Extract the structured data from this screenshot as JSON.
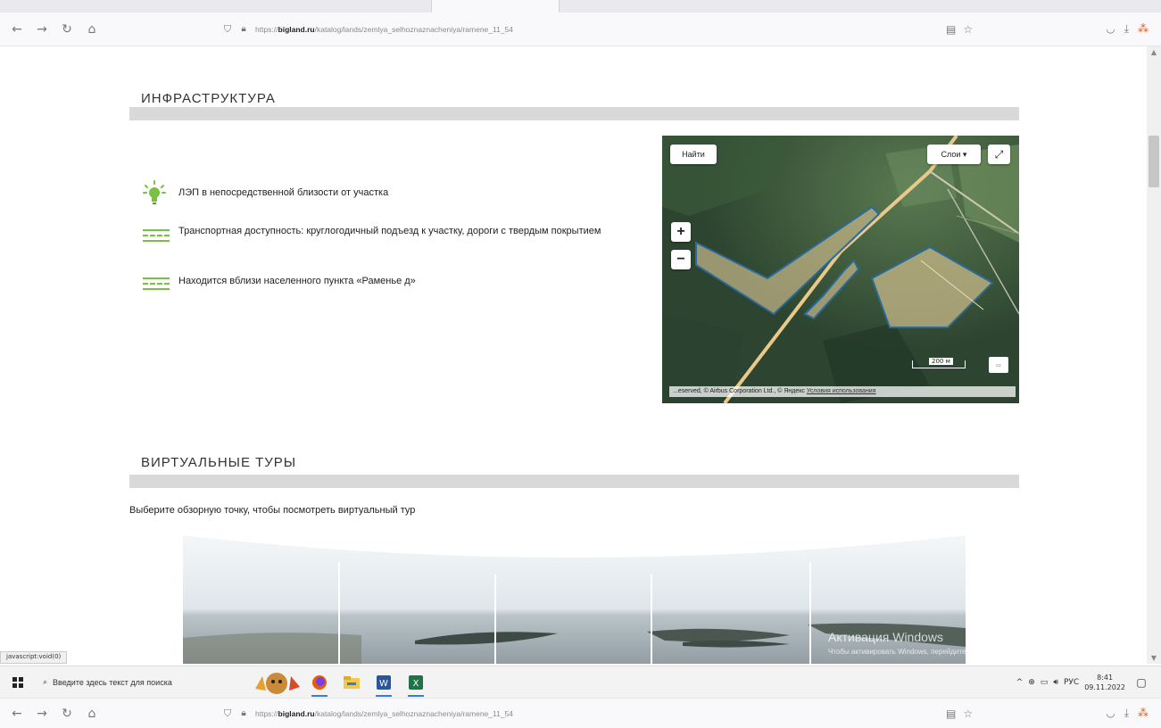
{
  "browser": {
    "url_prefix": "https://",
    "url_domain": "bigland.ru",
    "url_path": "/katalog/lands/zemlya_selhoznaznacheniya/ramene_11_54",
    "nav": {
      "back": "←",
      "forward": "→",
      "reload": "↻",
      "home": "⌂"
    }
  },
  "infrastructure": {
    "title": "ИНФРАСТРУКТУРА",
    "items": [
      {
        "icon": "lightbulb-icon",
        "text": "ЛЭП в непосредственной близости от участка"
      },
      {
        "icon": "road-icon",
        "text": "Транспортная доступность: круглогодичный подъезд к участку, дороги с твердым покрытием"
      },
      {
        "icon": "road-icon",
        "text": "Находится вблизи населенного пункта «Раменье д»"
      }
    ]
  },
  "map": {
    "find_label": "Найти",
    "layers_label": "Слои ▾",
    "zoom_in": "+",
    "zoom_out": "−",
    "scale_label": "200 м",
    "copyright": "...eserved, © Airbus Corporation Ltd., © Яндекс",
    "terms": "Условия использования"
  },
  "tours": {
    "title": "ВИРТУАЛЬНЫЕ ТУРЫ",
    "hint": "Выберите обзорную точку, чтобы посмотреть виртуальный тур"
  },
  "watermark": {
    "line1": "Активация Windows",
    "line2": "Чтобы активировать Windows, перейдите в раздел"
  },
  "status_link": "javascript:void(0)",
  "taskbar": {
    "search_placeholder": "Введите здесь текст для поиска",
    "language": "РУС",
    "time": "8:41",
    "date": "09.11.2022"
  },
  "colors": {
    "accent_green": "#7bc043",
    "section_bar": "#d9d9d9"
  }
}
